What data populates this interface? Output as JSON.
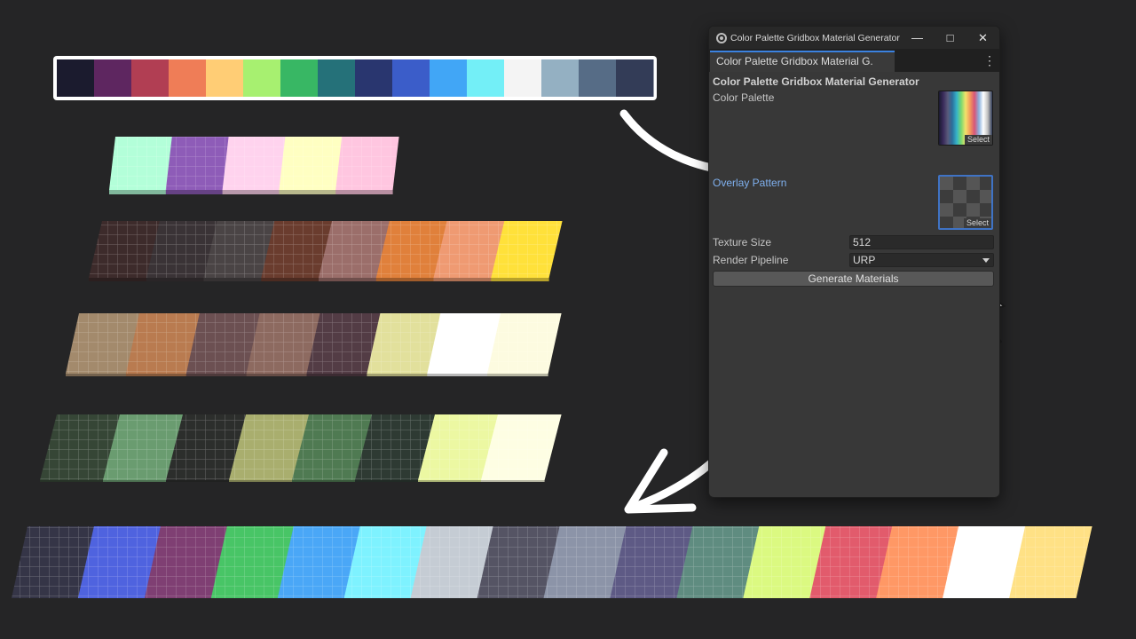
{
  "window": {
    "title": "Color Palette Gridbox Material Generator",
    "tab_label": "Color Palette Gridbox Material G.",
    "header": "Color Palette Gridbox Material Generator",
    "fields": {
      "color_palette_label": "Color Palette",
      "overlay_pattern_label": "Overlay Pattern",
      "select_label": "Select",
      "texture_size_label": "Texture Size",
      "texture_size_value": "512",
      "render_pipeline_label": "Render Pipeline",
      "render_pipeline_value": "URP"
    },
    "generate_button": "Generate Materials",
    "icons": [
      "unity-icon",
      "minimize-icon",
      "maximize-icon",
      "close-icon",
      "kebab-menu-icon"
    ]
  },
  "palette_strip": [
    "#1b1b2e",
    "#5e2660",
    "#b13e53",
    "#ef7d57",
    "#ffcd75",
    "#a7f070",
    "#38b764",
    "#257179",
    "#29366f",
    "#3b5dc9",
    "#41a6f6",
    "#73eff7",
    "#f4f4f4",
    "#94b0c2",
    "#566c86",
    "#333c57"
  ],
  "grid_rows": [
    {
      "grid": "light",
      "colors": [
        "#b3ffd9",
        "#8e5cb8",
        "#ffd3ee",
        "#ffffc2",
        "#ffc6e0"
      ]
    },
    {
      "grid": "light",
      "colors": [
        "#3d2b2b",
        "#3a3336",
        "#4a4445",
        "#6a3c2e",
        "#9b6e6a",
        "#e0803b",
        "#ef9a72",
        "#ffe13a"
      ]
    },
    {
      "grid": "light",
      "colors": [
        "#a38a6c",
        "#b97b50",
        "#6c5052",
        "#8d6a60",
        "#533c45",
        "#e2e09c",
        "#ffffff",
        "#fdfbe0"
      ]
    },
    {
      "grid": "light",
      "colors": [
        "#364636",
        "#6a9c70",
        "#2c2e2c",
        "#a9ae6e",
        "#4f7a52",
        "#2e3a33",
        "#ecf8a2",
        "#fefee3"
      ]
    },
    {
      "grid": "light",
      "colors": [
        "#353547",
        "#4f63df",
        "#7f3f73",
        "#48c566",
        "#4aa7f7",
        "#7ef2ff",
        "#c5ccd4",
        "#555464",
        "#8c94a8",
        "#5e5a85",
        "#5f8c80",
        "#dbf981",
        "#e25b6c",
        "#ff9865",
        "#ffffff",
        "#ffe185"
      ]
    }
  ]
}
